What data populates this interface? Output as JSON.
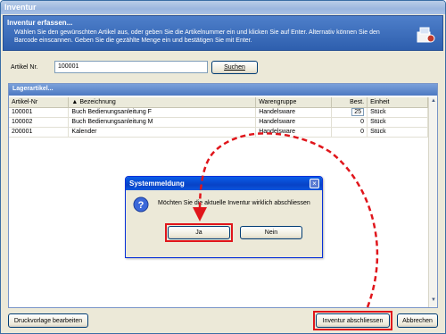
{
  "window": {
    "title": "Inventur"
  },
  "header": {
    "title": "Inventur erfassen...",
    "description": "Wählen Sie den gewünschten Artikel aus, oder geben Sie die Artikelnummer ein und klicken Sie auf Enter. Alternativ können Sie den Barcode einscannen. Geben Sie die gezählte Menge ein und bestätigen Sie mit Enter."
  },
  "search": {
    "label": "Artikel Nr.",
    "value": "100001",
    "button": "Suchen"
  },
  "group": {
    "title": "Lagerartikel...",
    "columns": [
      "Artikel-Nr",
      "Bezeichnung",
      "Warengruppe",
      "Best.",
      "Einheit"
    ],
    "rows": [
      [
        "100001",
        "Buch Bedienungsanleitung F",
        "Handelsware",
        "25",
        "Stück"
      ],
      [
        "100002",
        "Buch Bedienungsanleitung M",
        "Handelsware",
        "0",
        "Stück"
      ],
      [
        "200001",
        "Kalender",
        "Handelsware",
        "0",
        "Stück"
      ]
    ]
  },
  "dialog": {
    "title": "Systemmeldung",
    "message": "Möchten Sie die aktuelle Inventur wirklich abschliessen",
    "yes": "Ja",
    "no": "Nein"
  },
  "buttons": {
    "print_template": "Druckvorlage bearbeiten",
    "finish": "Inventur abschliessen",
    "cancel": "Abbrechen"
  },
  "colors": {
    "highlight": "#e0151b",
    "header": "#2e5fae"
  }
}
